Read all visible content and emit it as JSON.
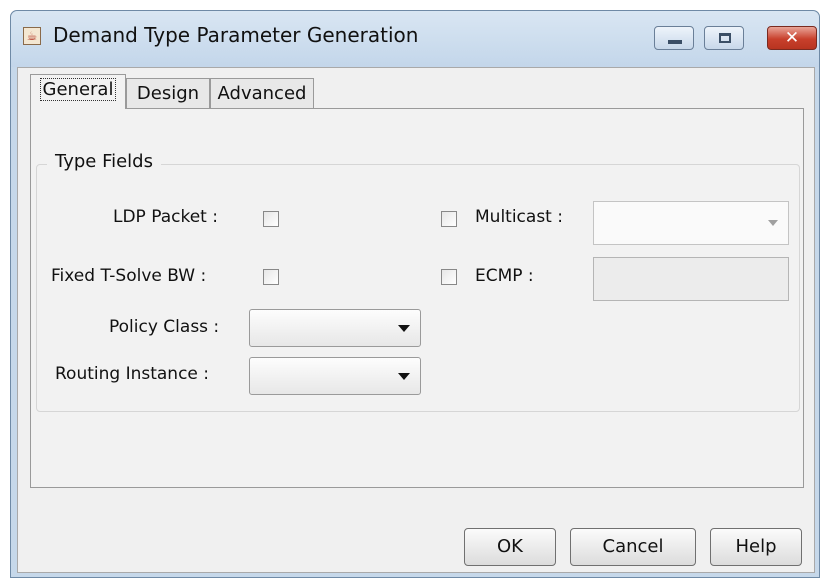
{
  "window": {
    "title": "Demand Type Parameter Generation",
    "app_icon": "java-cup-icon"
  },
  "tabs": [
    {
      "label": "General",
      "active": true
    },
    {
      "label": "Design",
      "active": false
    },
    {
      "label": "Advanced",
      "active": false
    }
  ],
  "group": {
    "title": "Type Fields",
    "ldp_packet_label": "LDP Packet :",
    "ldp_packet_checked": false,
    "fixed_tsolve_label": "Fixed T-Solve BW :",
    "fixed_tsolve_checked": false,
    "policy_class_label": "Policy Class :",
    "policy_class_value": "",
    "routing_instance_label": "Routing Instance :",
    "routing_instance_value": "",
    "multicast_label": "Multicast :",
    "multicast_checked": false,
    "multicast_value": "",
    "ecmp_label": "ECMP :",
    "ecmp_checked": false,
    "ecmp_value": ""
  },
  "buttons": {
    "ok": "OK",
    "cancel": "Cancel",
    "help": "Help"
  }
}
